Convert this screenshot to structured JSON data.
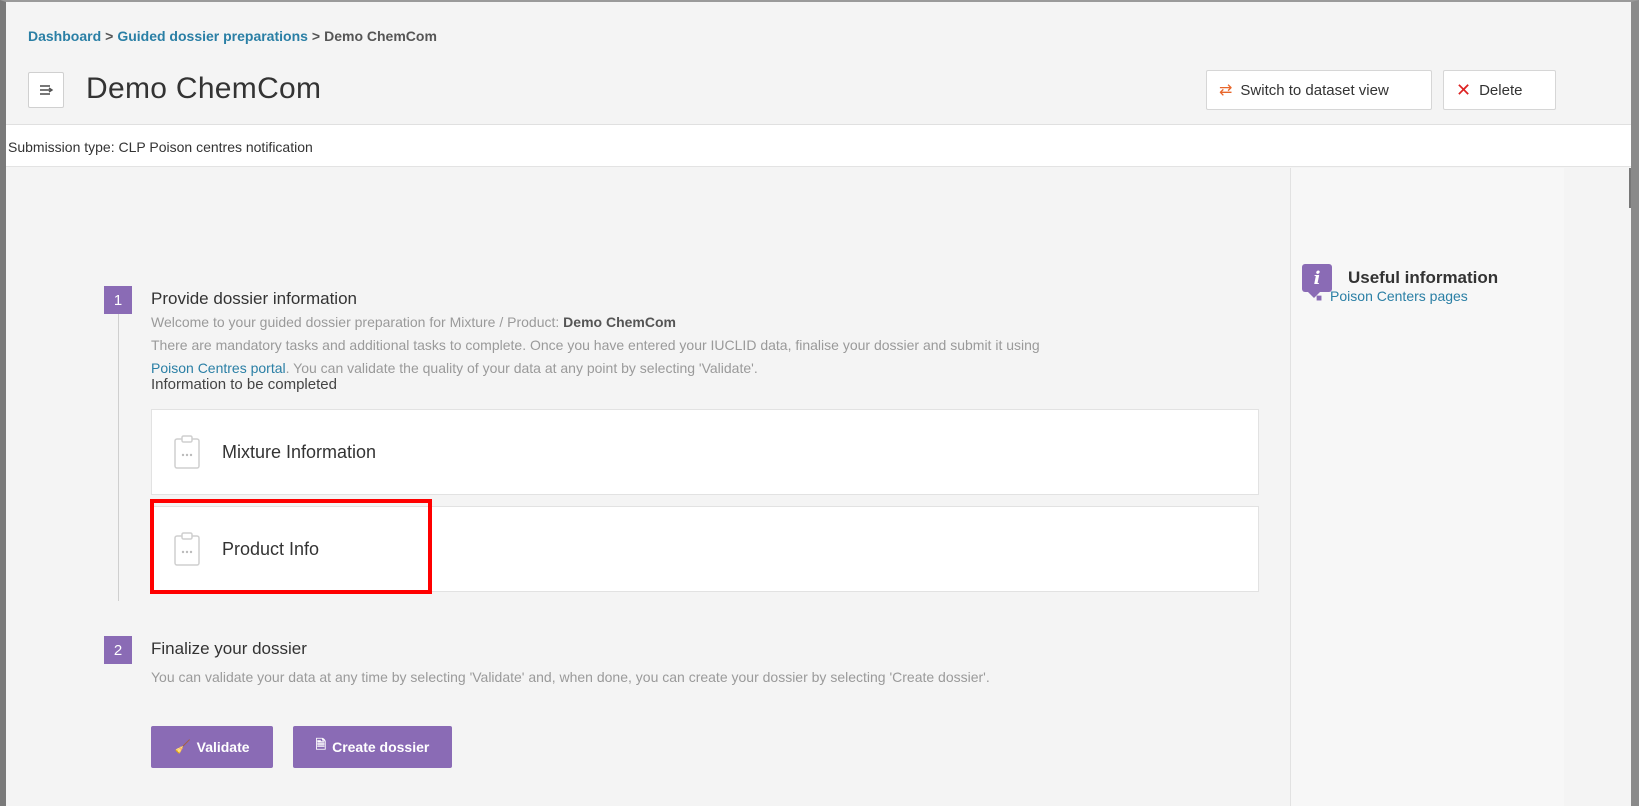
{
  "breadcrumb": {
    "dashboard": "Dashboard",
    "sep1": ">",
    "guided": "Guided dossier preparations",
    "sep2": ">",
    "current": "Demo ChemCom"
  },
  "page": {
    "title": "Demo ChemCom"
  },
  "header_buttons": {
    "switch_label": "Switch to dataset view",
    "switch_icon": "swap-arrows-icon",
    "delete_label": "Delete",
    "delete_icon": "close-icon"
  },
  "submission": {
    "text": "Submission type: CLP Poison centres notification"
  },
  "step1": {
    "number": "1",
    "title": "Provide dossier information",
    "welcome_prefix": "Welcome to your guided dossier preparation for Mixture / Product: ",
    "welcome_product": "Demo ChemCom",
    "line2": "There are mandatory tasks and additional tasks to complete. Once you have entered your IUCLID data, finalise your dossier and submit it using",
    "portal_link": "Poison Centres portal",
    "line3": ". You can validate the quality of your data at any point by selecting 'Validate'.",
    "section_label": "Information to be completed",
    "cards": [
      {
        "label": "Mixture Information",
        "icon": "clipboard-icon"
      },
      {
        "label": "Product Info",
        "icon": "clipboard-icon"
      }
    ]
  },
  "step2": {
    "number": "2",
    "title": "Finalize your dossier",
    "text": "You can validate your data at any time by selecting 'Validate' and, when done, you can create your dossier by selecting 'Create dossier'.",
    "validate_label": "Validate",
    "validate_icon": "broom-icon",
    "create_label": "Create dossier",
    "create_icon": "document-icon"
  },
  "sidebar": {
    "title": "Useful information",
    "icon": "info-icon",
    "links": [
      "Poison Centers pages"
    ]
  },
  "colors": {
    "accent_purple": "#8a6bb5",
    "link_blue": "#2a7fa5",
    "highlight_red": "#ff0000",
    "switch_orange": "#e8662a"
  }
}
